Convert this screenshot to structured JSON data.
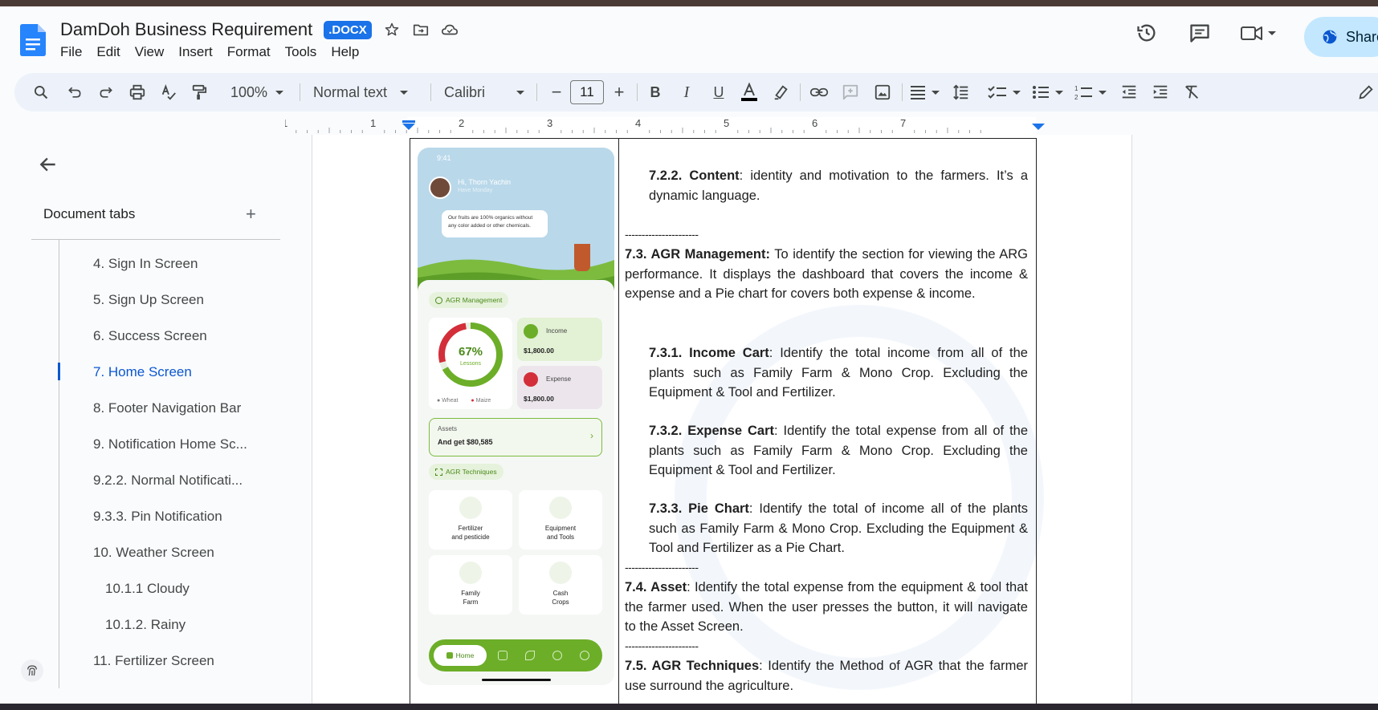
{
  "header": {
    "title": "DamDoh Business Requirement",
    "ext_badge": ".DOCX",
    "share_label": "Share"
  },
  "menu": [
    "File",
    "Edit",
    "View",
    "Insert",
    "Format",
    "Tools",
    "Help"
  ],
  "toolbar": {
    "zoom": "100%",
    "style": "Normal text",
    "font": "Calibri",
    "font_size": "11"
  },
  "ruler": {
    "marks": [
      "1",
      "1",
      "2",
      "3",
      "4",
      "5",
      "6",
      "7"
    ]
  },
  "sidebar": {
    "tabs_title": "Document tabs",
    "items": [
      {
        "label": "4. Sign In Screen",
        "active": false
      },
      {
        "label": "5. Sign Up Screen",
        "active": false
      },
      {
        "label": "6. Success Screen",
        "active": false
      },
      {
        "label": "7. Home Screen",
        "active": true
      },
      {
        "label": "8. Footer Navigation Bar",
        "active": false
      },
      {
        "label": "9. Notification Home Sc...",
        "active": false
      },
      {
        "label": "9.2.2. Normal Notificati...",
        "active": false
      },
      {
        "label": "9.3.3. Pin Notification",
        "active": false
      },
      {
        "label": "10. Weather Screen",
        "active": false
      },
      {
        "label": "10.1.1 Cloudy",
        "active": false
      },
      {
        "label": "10.1.2. Rainy",
        "active": false
      },
      {
        "label": "11. Fertilizer Screen",
        "active": false
      }
    ]
  },
  "phone": {
    "time": "9:41",
    "greeting": "Hi, Thorn Yachin",
    "subtitle": "Have Monday",
    "bubble": "Our fruits are 100% organics without any color added or other chemicals.",
    "agr_management": "AGR Management",
    "percent": "67%",
    "percent_label": "Lessons",
    "legend_a": "Wheat",
    "legend_b": "Maize",
    "income_label": "Income",
    "income_value": "$1,800.00",
    "expense_label": "Expense",
    "expense_value": "$1,800.00",
    "assets_label": "Assets",
    "assets_value": "And get $80,585",
    "agr_techniques": "AGR Techniques",
    "tiles": [
      "Fertilizer\nand pesticide",
      "Equipment\nand Tools",
      "Family\nFarm",
      "Cash\nCrops"
    ],
    "nav_home": "Home"
  },
  "doc": {
    "s722_head": "7.2.2. Content",
    "s722_text": ": identity and motivation to the farmers. It’s a dynamic language.",
    "dashes": "----------------------",
    "s73_head": "7.3. AGR Management:",
    "s73_text": " To identify the section for viewing the ARG performance. It displays the dashboard that covers the income & expense and a Pie chart for covers both expense & income.",
    "s731_head": "7.3.1. Income Cart",
    "s731_text": ": Identify the total income from all of the plants such as Family Farm & Mono Crop. Excluding the Equipment & Tool and Fertilizer.",
    "s732_head": "7.3.2. Expense Cart",
    "s732_text": ": Identify the total expense from all of the plants such as Family Farm & Mono Crop. Excluding the Equipment & Tool and Fertilizer.",
    "s733_head": "7.3.3. Pie Chart",
    "s733_text": ": Identify the total of income all of the plants such as Family Farm & Mono Crop. Excluding the Equipment & Tool and Fertilizer as a Pie Chart.",
    "s74_head": "7.4. Asset",
    "s74_text": ": Identify the total expense from the equipment & tool that the farmer used. When the user presses the button, it will navigate to the Asset Screen.",
    "s75_head": "7.5. AGR Techniques",
    "s75_text": ": Identify the Method of AGR that the farmer use surround the agriculture."
  },
  "colors": {
    "accent": "#1a73e8",
    "share_bg": "#c2e7ff",
    "toolbar_bg": "#edf2fa",
    "active_outline": "#0b57d0",
    "app_green": "#6cae28",
    "app_red": "#d32f3a"
  },
  "icons": [
    "docs-logo-icon",
    "star-icon",
    "folder-move-icon",
    "cloud-icon",
    "history-icon",
    "comment-icon",
    "video-icon",
    "globe-icon",
    "search-icon",
    "undo-icon",
    "redo-icon",
    "print-icon",
    "spellcheck-icon",
    "paint-format-icon",
    "bold-icon",
    "italic-icon",
    "underline-icon",
    "text-color-icon",
    "highlight-icon",
    "link-icon",
    "add-comment-icon",
    "image-icon",
    "align-icon",
    "line-spacing-icon",
    "checklist-icon",
    "bullet-list-icon",
    "numbered-list-icon",
    "indent-decrease-icon",
    "indent-increase-icon",
    "clear-format-icon",
    "edit-pencil-icon",
    "back-arrow-icon",
    "plus-icon",
    "fingerprint-icon"
  ]
}
